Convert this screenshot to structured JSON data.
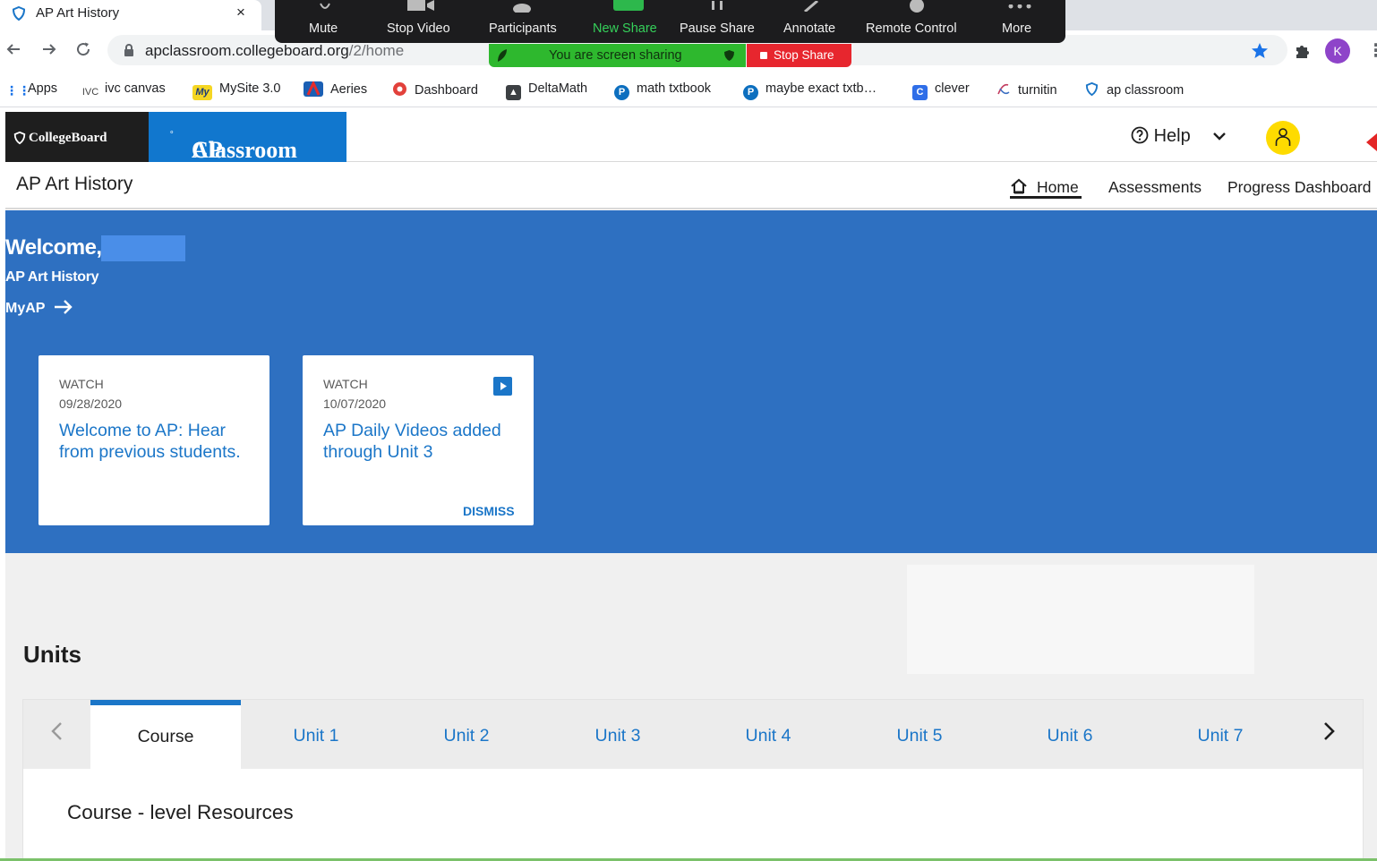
{
  "browser": {
    "tab_title": "AP Art History",
    "tab_close": "×",
    "url_domain": "apclassroom.collegeboard.org",
    "url_path": "/2/home",
    "profile_initial": "K",
    "bookmarks": [
      {
        "label": "Apps",
        "icon": "apps-grid-icon"
      },
      {
        "label": "ivc canvas",
        "icon": "ivc-icon"
      },
      {
        "label": "MySite 3.0",
        "icon": "mysite-icon"
      },
      {
        "label": "Aeries",
        "icon": "aeries-icon"
      },
      {
        "label": "Dashboard",
        "icon": "dashboard-icon"
      },
      {
        "label": "DeltaMath",
        "icon": "deltamath-icon"
      },
      {
        "label": "math txtbook",
        "icon": "pearson-icon"
      },
      {
        "label": "maybe exact txtb…",
        "icon": "pearson-icon"
      },
      {
        "label": "clever",
        "icon": "clever-icon"
      },
      {
        "label": "turnitin",
        "icon": "turnitin-icon"
      },
      {
        "label": "ap classroom",
        "icon": "collegeboard-icon"
      }
    ],
    "bookmark_ivc_glyph": "IVC",
    "bookmark_mysite_glyph": "My",
    "bookmark_clever_glyph": "C"
  },
  "zoom": {
    "buttons": [
      "Mute",
      "Stop Video",
      "Participants",
      "New Share",
      "Pause Share",
      "Annotate",
      "Remote Control",
      "More"
    ],
    "sharing_notice": "You are screen sharing",
    "stop_share": "Stop Share",
    "colors": {
      "bar": "#1c1c1e",
      "notice": "#2eb82e",
      "stop": "#e7262e"
    }
  },
  "header": {
    "collegeboard_logo": "CollegeBoard",
    "ap_logo": "AP",
    "ap_logo_rest": "Classroom",
    "help_label": "Help"
  },
  "subnav": {
    "course_title": "AP Art History",
    "links": [
      "Home",
      "Assessments",
      "Progress Dashboard"
    ]
  },
  "hero": {
    "welcome": "Welcome,",
    "course": "AP Art History",
    "myap": "MyAP",
    "cards": [
      {
        "type": "WATCH",
        "date": "09/28/2020",
        "title": "Welcome to AP: Hear from previous students."
      },
      {
        "type": "WATCH",
        "date": "10/07/2020",
        "title": "AP Daily Videos added through Unit 3",
        "dismiss": "DISMISS"
      }
    ],
    "colors": {
      "background": "#2e70c1",
      "link": "#1b76c8"
    }
  },
  "units": {
    "heading": "Units",
    "tabs": [
      "Course",
      "Unit 1",
      "Unit 2",
      "Unit 3",
      "Unit 4",
      "Unit 5",
      "Unit 6",
      "Unit 7"
    ],
    "active_tab": "Course",
    "resources_title": "Course - level Resources"
  }
}
